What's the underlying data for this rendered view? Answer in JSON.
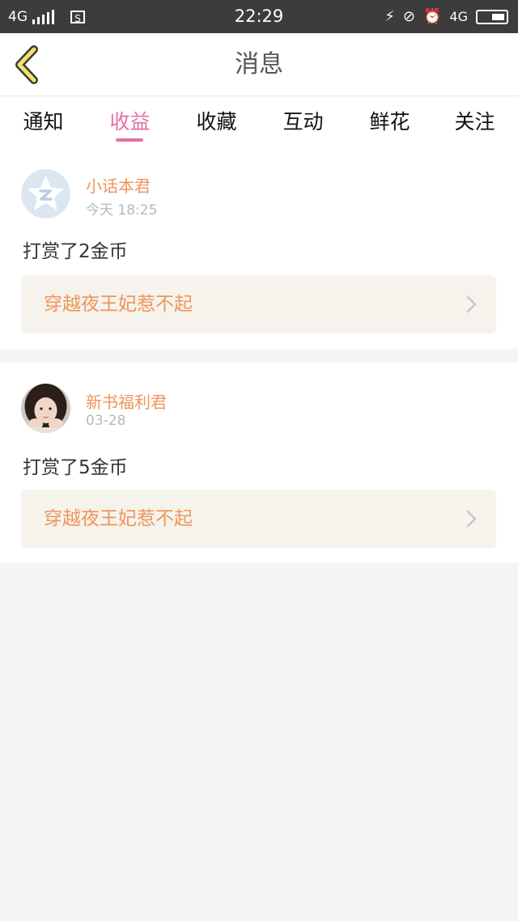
{
  "status_bar": {
    "network_left": "4G",
    "time": "22:29",
    "network_right": "4G"
  },
  "header": {
    "title": "消息",
    "back_icon": "chevron-left-icon"
  },
  "tabs": [
    {
      "label": "通知",
      "active": false
    },
    {
      "label": "收益",
      "active": true
    },
    {
      "label": "收藏",
      "active": false
    },
    {
      "label": "互动",
      "active": false
    },
    {
      "label": "鲜花",
      "active": false
    },
    {
      "label": "关注",
      "active": false
    }
  ],
  "messages": [
    {
      "username": "小话本君",
      "time": "今天 18:25",
      "text": "打赏了2金币",
      "book_title": "穿越夜王妃惹不起",
      "avatar": "star-logo-avatar"
    },
    {
      "username": "新书福利君",
      "time": "03-28",
      "text": "打赏了5金币",
      "book_title": "穿越夜王妃惹不起",
      "avatar": "girl-photo-avatar"
    }
  ],
  "colors": {
    "accent_pink": "#e76fa3",
    "orange_text": "#f0955b",
    "status_bar": "#3c3c3c",
    "back_icon_yellow": "#f2e26a"
  }
}
